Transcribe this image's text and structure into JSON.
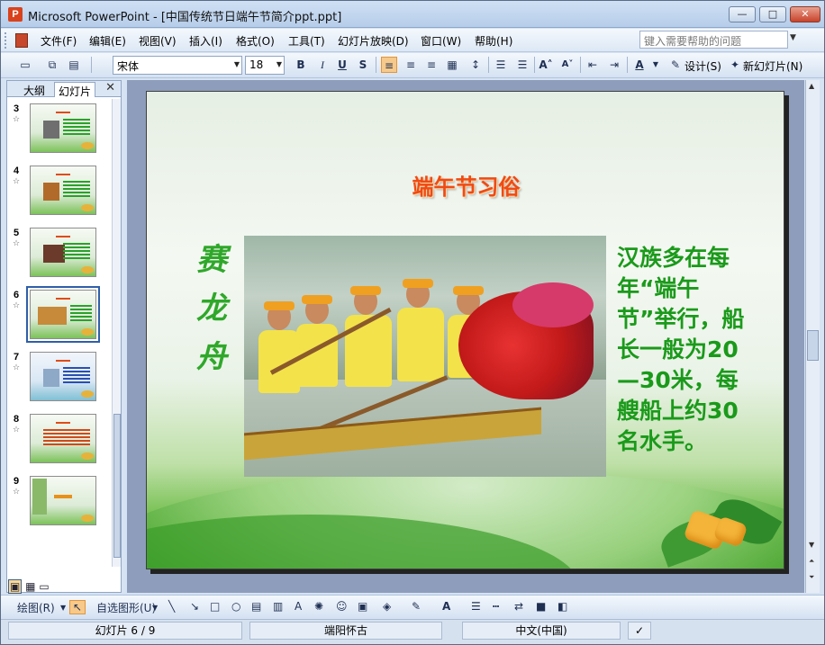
{
  "window": {
    "title": "Microsoft PowerPoint - [中国传统节日端午节简介ppt.ppt]",
    "app_icon": "powerpoint-icon"
  },
  "menu": {
    "items": [
      "文件(F)",
      "编辑(E)",
      "视图(V)",
      "插入(I)",
      "格式(O)",
      "工具(T)",
      "幻灯片放映(D)",
      "窗口(W)",
      "帮助(H)"
    ],
    "help_placeholder": "键入需要帮助的问题"
  },
  "toolbar": {
    "font_name": "宋体",
    "font_size": "18",
    "bold": "B",
    "italic": "I",
    "underline": "U",
    "shadow": "S",
    "design_label": "设计(S)",
    "new_slide_label": "新幻灯片(N)"
  },
  "left_panel": {
    "tabs": [
      "大纲",
      "幻灯片"
    ],
    "thumbnails": [
      {
        "num": "3"
      },
      {
        "num": "4"
      },
      {
        "num": "5"
      },
      {
        "num": "6",
        "selected": true
      },
      {
        "num": "7"
      },
      {
        "num": "8"
      },
      {
        "num": "9"
      }
    ]
  },
  "slide": {
    "title": "端午节习俗",
    "vertical_title": [
      "赛",
      "龙",
      "舟"
    ],
    "body": "汉族多在每年“端午节”举行，船长一般为20—30米，每艘船上约30名水手。"
  },
  "draw_toolbar": {
    "draw_label": "绘图(R)",
    "autoshape_label": "自选图形(U)"
  },
  "status": {
    "slide_position": "幻灯片 6 / 9",
    "design_name": "端阳怀古",
    "language": "中文(中国)"
  },
  "colors": {
    "title_color": "#f04a14",
    "text_green": "#1a9a1a",
    "accent_blue": "#2f5fa8"
  }
}
